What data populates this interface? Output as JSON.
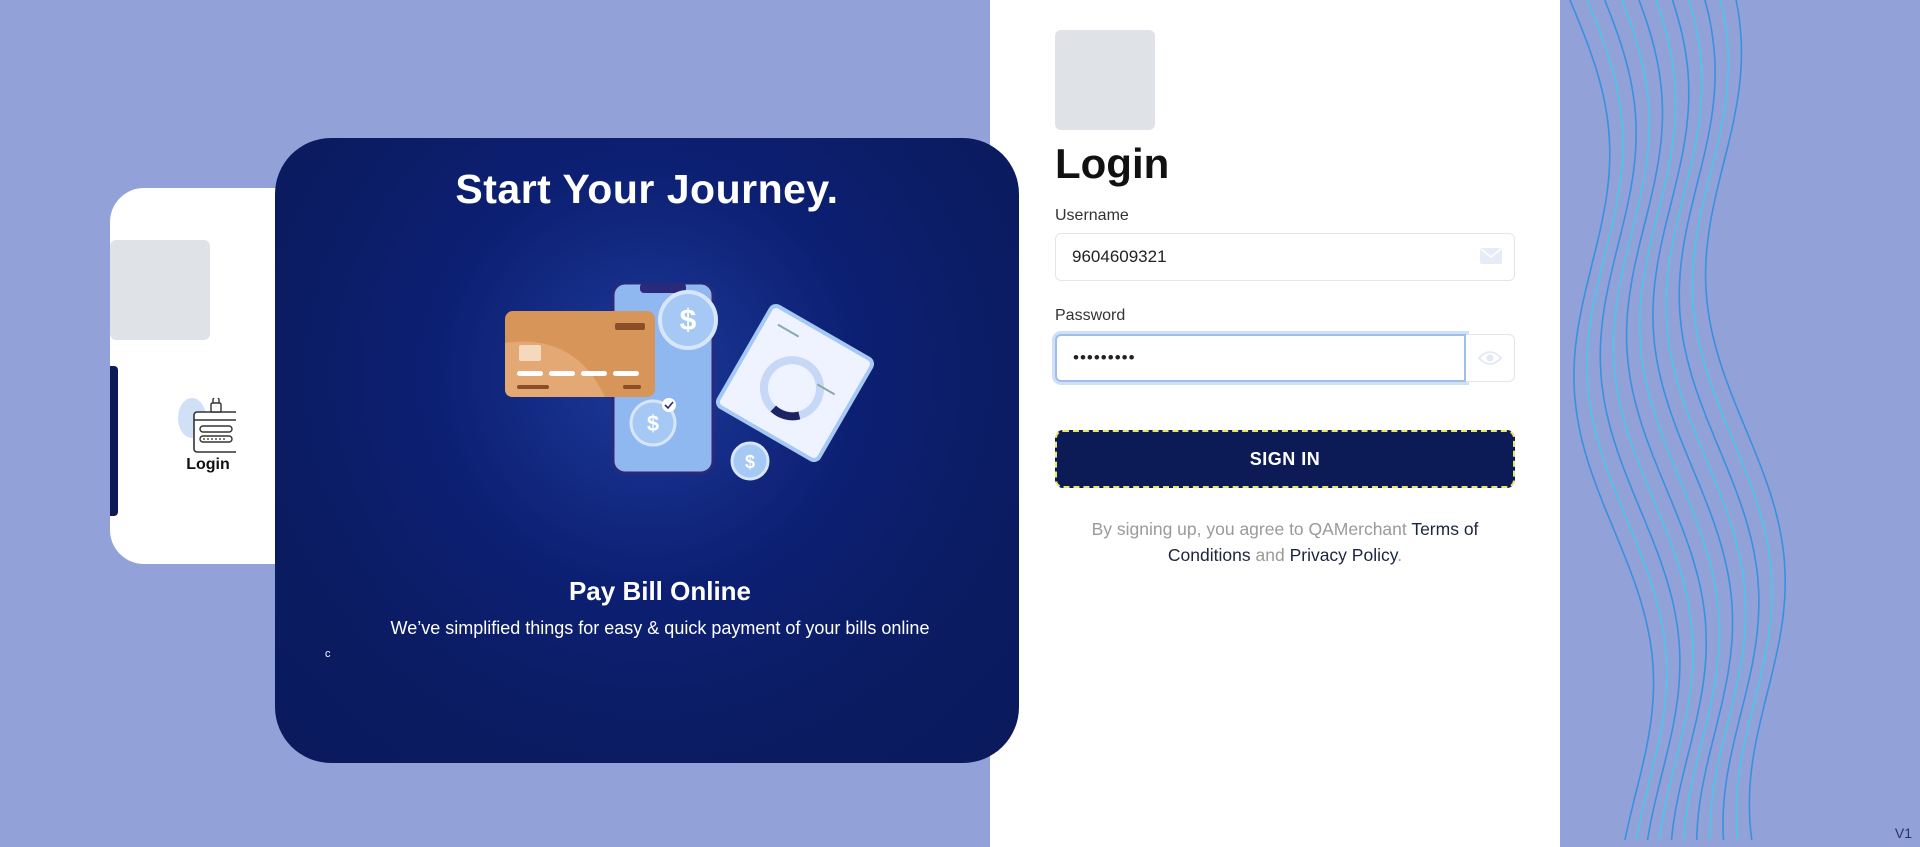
{
  "sidebar": {
    "item_label": "Login"
  },
  "hero": {
    "title": "Start Your Journey.",
    "subtitle": "Pay Bill Online",
    "description": "We’ve simplified things for easy & quick payment of your bills online",
    "slide_indicator": "c",
    "illustration": {
      "card_color": "#d8955a",
      "phone_color": "#8fb8f0",
      "dollar_symbol": "$"
    }
  },
  "login": {
    "title": "Login",
    "username_label": "Username",
    "username_value": "9604609321",
    "password_label": "Password",
    "password_value": "•••••••••",
    "signin_label": "SIGN IN",
    "terms_prefix": "By signing up, you agree to QAMerchant ",
    "terms_link": "Terms of Conditions",
    "terms_and": " and ",
    "privacy_link": "Privacy Policy",
    "terms_suffix": "."
  },
  "version": "V1",
  "colors": {
    "background": "#93a1d9",
    "hero": "#0c1f72",
    "accent": "#0c1a55",
    "wave": "#3aa8ea"
  }
}
